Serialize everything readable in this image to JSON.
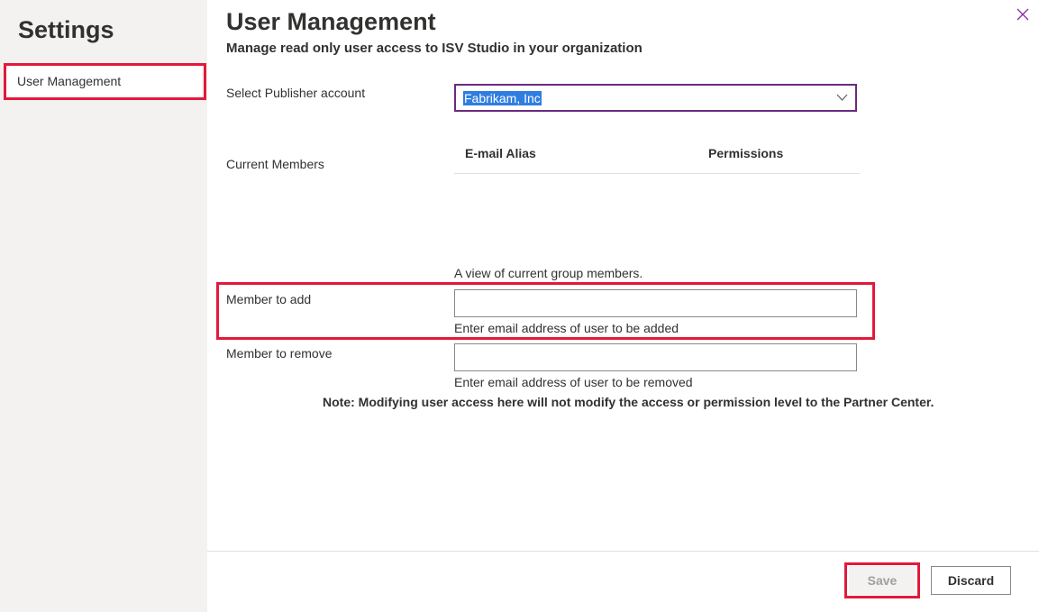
{
  "sidebar": {
    "title": "Settings",
    "items": [
      {
        "label": "User Management"
      }
    ]
  },
  "header": {
    "title": "User Management",
    "subtitle": "Manage read only user access to ISV Studio in your organization"
  },
  "publisher": {
    "label": "Select Publisher account",
    "selected": "Fabrikam, Inc"
  },
  "members": {
    "label": "Current Members",
    "columns": [
      "E-mail Alias",
      "Permissions"
    ],
    "rows": [],
    "helper": "A view of current group members."
  },
  "add_member": {
    "label": "Member to add",
    "value": "",
    "helper": "Enter email address of user to be added"
  },
  "remove_member": {
    "label": "Member to remove",
    "value": "",
    "helper": "Enter email address of user to be removed"
  },
  "note": "Note: Modifying user access here will not modify the access or permission level to the Partner Center.",
  "footer": {
    "save_label": "Save",
    "discard_label": "Discard"
  },
  "icons": {
    "close": "close-icon",
    "dropdown": "chevron-down-icon"
  },
  "colors": {
    "highlight": "#e3193a",
    "accent": "#6b2a80",
    "selection": "#2f7de1",
    "sidebar_bg": "#f3f2f1"
  }
}
